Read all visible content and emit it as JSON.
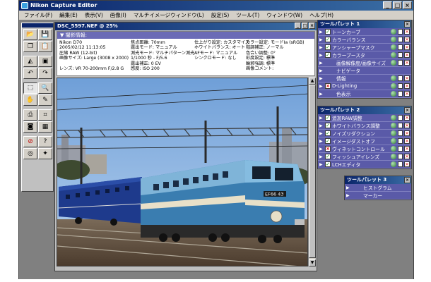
{
  "window": {
    "title": "Nikon Capture Editor"
  },
  "menu": [
    "ファイル(F)",
    "編集(E)",
    "表示(V)",
    "画像(I)",
    "マルチイメージウィンドウ(L)",
    "設定(S)",
    "ツール(T)",
    "ウィンドウ(W)",
    "ヘルプ(H)"
  ],
  "image_window": {
    "title": "DSC_5597.NEF @ 25%",
    "section_title": "撮影情報:",
    "col1": [
      "Nikon D70",
      "2005/02/12 11:13:05",
      "圧縮 RAW (12-bit)",
      "画像サイズ: Large (3008 x 2000)",
      "",
      "レンズ: VR 70-200mm F/2.8 G"
    ],
    "col2": [
      "焦点距離: 70mm",
      "露出モード: マニュアル",
      "測光モード: マルチパターン測光",
      "1/1000 秒 - F/5.6",
      "露出補正: 0 EV",
      "感度: ISO 200"
    ],
    "col3": [
      "仕上がり設定: カスタマイズ",
      "ホワイトバランス: オート",
      "AFモード: マニュアル",
      "シンクロモード: なし"
    ],
    "col4": [
      "カラー設定: モードIa (sRGB)",
      "階調補正: ノーマル",
      "色合い調整: 0°",
      "彩度設定: 標準",
      "輪郭強調: 標準",
      "画像コメント:"
    ],
    "plate": "EF66 43"
  },
  "palette1": {
    "title": "ツールパレット 1",
    "items": [
      {
        "label": "トーンカーブ",
        "check": "on",
        "ctrl": true
      },
      {
        "label": "カラーバランス",
        "check": "on",
        "ctrl": true
      },
      {
        "label": "アンシャープマスク",
        "check": "on",
        "ctrl": true
      },
      {
        "label": "カラーブースタ",
        "check": "on",
        "ctrl": true
      },
      {
        "label": "画像解像度/画像サイズ",
        "check": "none",
        "ctrl": true
      },
      {
        "label": "ナビゲータ",
        "check": "none",
        "ctrl": false
      },
      {
        "label": "情報",
        "check": "none",
        "ctrl": true
      },
      {
        "label": "D-Lighting",
        "check": "x",
        "ctrl": true
      },
      {
        "label": "色表示",
        "check": "none",
        "ctrl": true
      }
    ]
  },
  "palette2": {
    "title": "ツールパレット 2",
    "items": [
      {
        "label": "追加RAW調整",
        "check": "on",
        "ctrl": true
      },
      {
        "label": "ホワイトバランス調整",
        "check": "on",
        "ctrl": true
      },
      {
        "label": "ノイズリダクション",
        "check": "on",
        "ctrl": true
      },
      {
        "label": "イメージダストオフ",
        "check": "on",
        "ctrl": true
      },
      {
        "label": "ヴィネットコントロール",
        "check": "x",
        "ctrl": true
      },
      {
        "label": "フィッシュアイレンズ",
        "check": "on",
        "ctrl": true
      },
      {
        "label": "LCHエディタ",
        "check": "on",
        "ctrl": true
      }
    ]
  },
  "palette3": {
    "title": "ツールパレット 3",
    "items": [
      {
        "label": "ヒストグラム",
        "check": "none",
        "ctrl": false
      },
      {
        "label": "マーカー",
        "check": "none",
        "ctrl": false
      }
    ]
  },
  "toolbox": [
    "open-folder-icon",
    "save-icon",
    "copy-icon",
    "paste-icon",
    "level-icon",
    "image-icon",
    "rotate-left-icon",
    "rotate-right-icon",
    "select-icon",
    "zoom-icon",
    "hand-icon",
    "eyedropper-icon",
    "print-icon",
    "crop-icon",
    "camera-icon",
    "grid-icon",
    "no-icon",
    "help-icon",
    "target-icon",
    "compass-icon"
  ]
}
